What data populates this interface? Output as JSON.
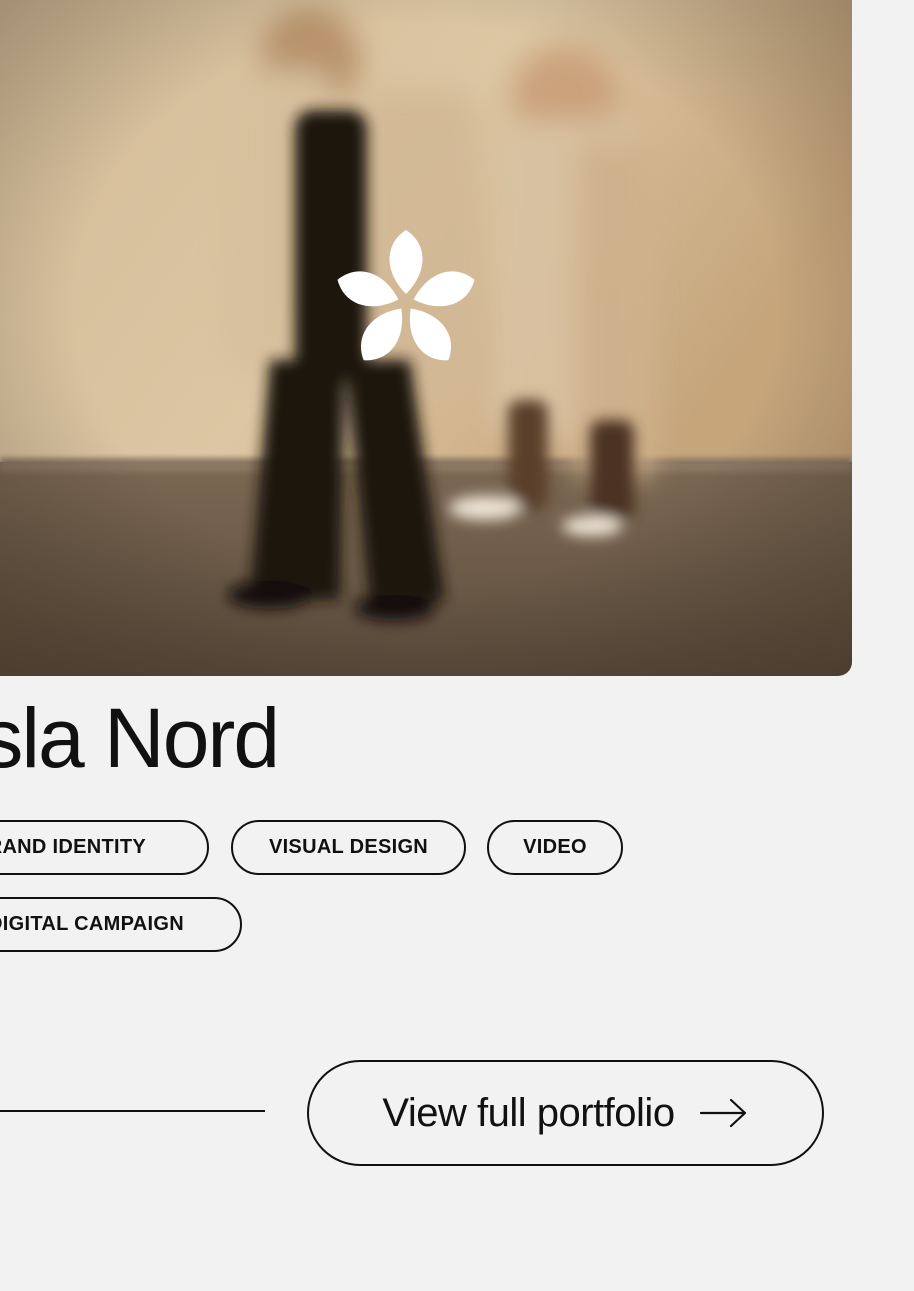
{
  "project": {
    "title": "Isla Nord",
    "image_alt": "Two blurred figures walking past a beige wall",
    "logo_icon": "flower-logo-icon"
  },
  "tags": [
    {
      "label": "BRAND IDENTITY"
    },
    {
      "label": "VISUAL DESIGN"
    },
    {
      "label": "VIDEO"
    },
    {
      "label": "DIGITAL CAMPAIGN"
    }
  ],
  "portfolio_button": {
    "label": "View full portfolio",
    "icon": "arrow-right-icon"
  },
  "colors": {
    "background": "#f2f2f2",
    "ink": "#111111",
    "photo_wall": "#cdb48f",
    "photo_floor": "#6b5a46",
    "logo": "#ffffff"
  }
}
